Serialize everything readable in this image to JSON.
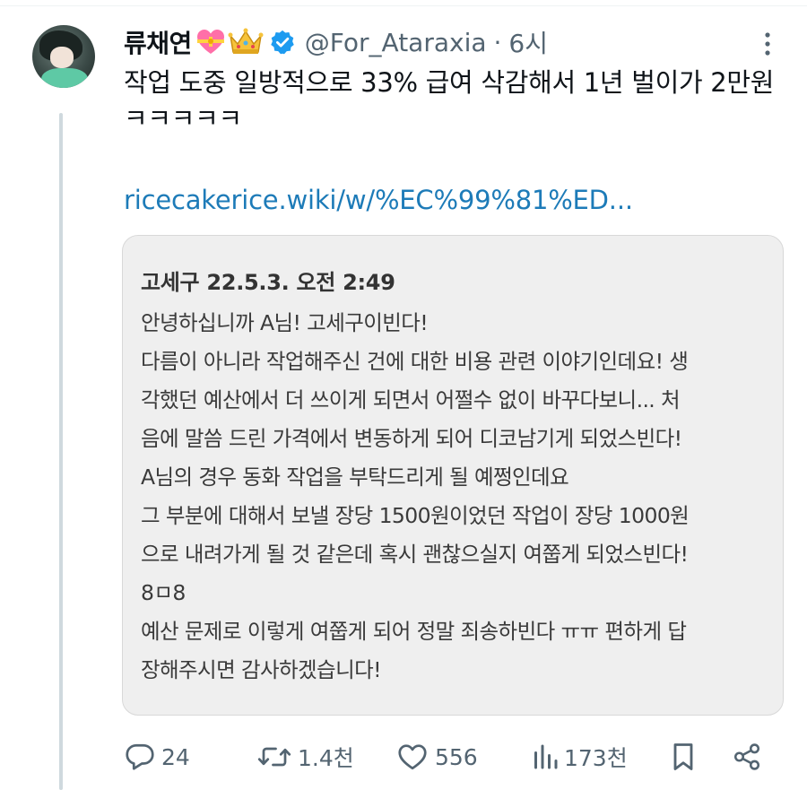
{
  "tweet": {
    "display_name": "류채연",
    "handle": "@For_Ataraxia",
    "separator": "·",
    "time": "6시",
    "text": "작업 도중 일방적으로 33% 급여 삭감해서 1년 벌이가 2만원ㅋㅋㅋㅋㅋ",
    "link": "ricecakerice.wiki/w/%EC%99%81%ED..."
  },
  "card": {
    "title": "고세구 22.5.3. 오전 2:49",
    "lines": [
      "안녕하십니까 A님! 고세구이빈다!",
      "다름이 아니라 작업해주신 건에 대한 비용 관련 이야기인데요! 생",
      "각했던 예산에서 더 쓰이게 되면서 어쩔수 없이 바꾸다보니... 처",
      "음에 말씀 드린 가격에서 변동하게 되어 디코남기게 되었스빈다!",
      "A님의 경우 동화 작업을 부탁드리게 될 예쩡인데요",
      "그 부분에 대해서 보낼 장당 1500원이었던 작업이 장당 1000원",
      "으로 내려가게 될 것 같은데 혹시 괜찮으실지 여쭙게 되었스빈다!",
      "8ㅁ8",
      "예산 문제로 이렇게 여쭙게 되어 정말 죄송하빈다 ㅠㅠ 편하게 답",
      "장해주시면 감사하겠습니다!"
    ]
  },
  "actions": {
    "replies": "24",
    "retweets": "1.4천",
    "likes": "556",
    "views": "173천"
  },
  "icons": {
    "reply": "reply-icon",
    "retweet": "retweet-icon",
    "like": "heart-icon",
    "views": "views-icon",
    "bookmark": "bookmark-icon",
    "share": "share-icon",
    "more": "more-vertical-icon",
    "verified": "verified-badge-icon",
    "emoji_heart": "heart-ribbon-emoji-icon",
    "emoji_crown": "crown-emoji-icon"
  },
  "colors": {
    "link": "#1d7bb8",
    "muted": "#536471",
    "verified": "#1d9bf0"
  }
}
